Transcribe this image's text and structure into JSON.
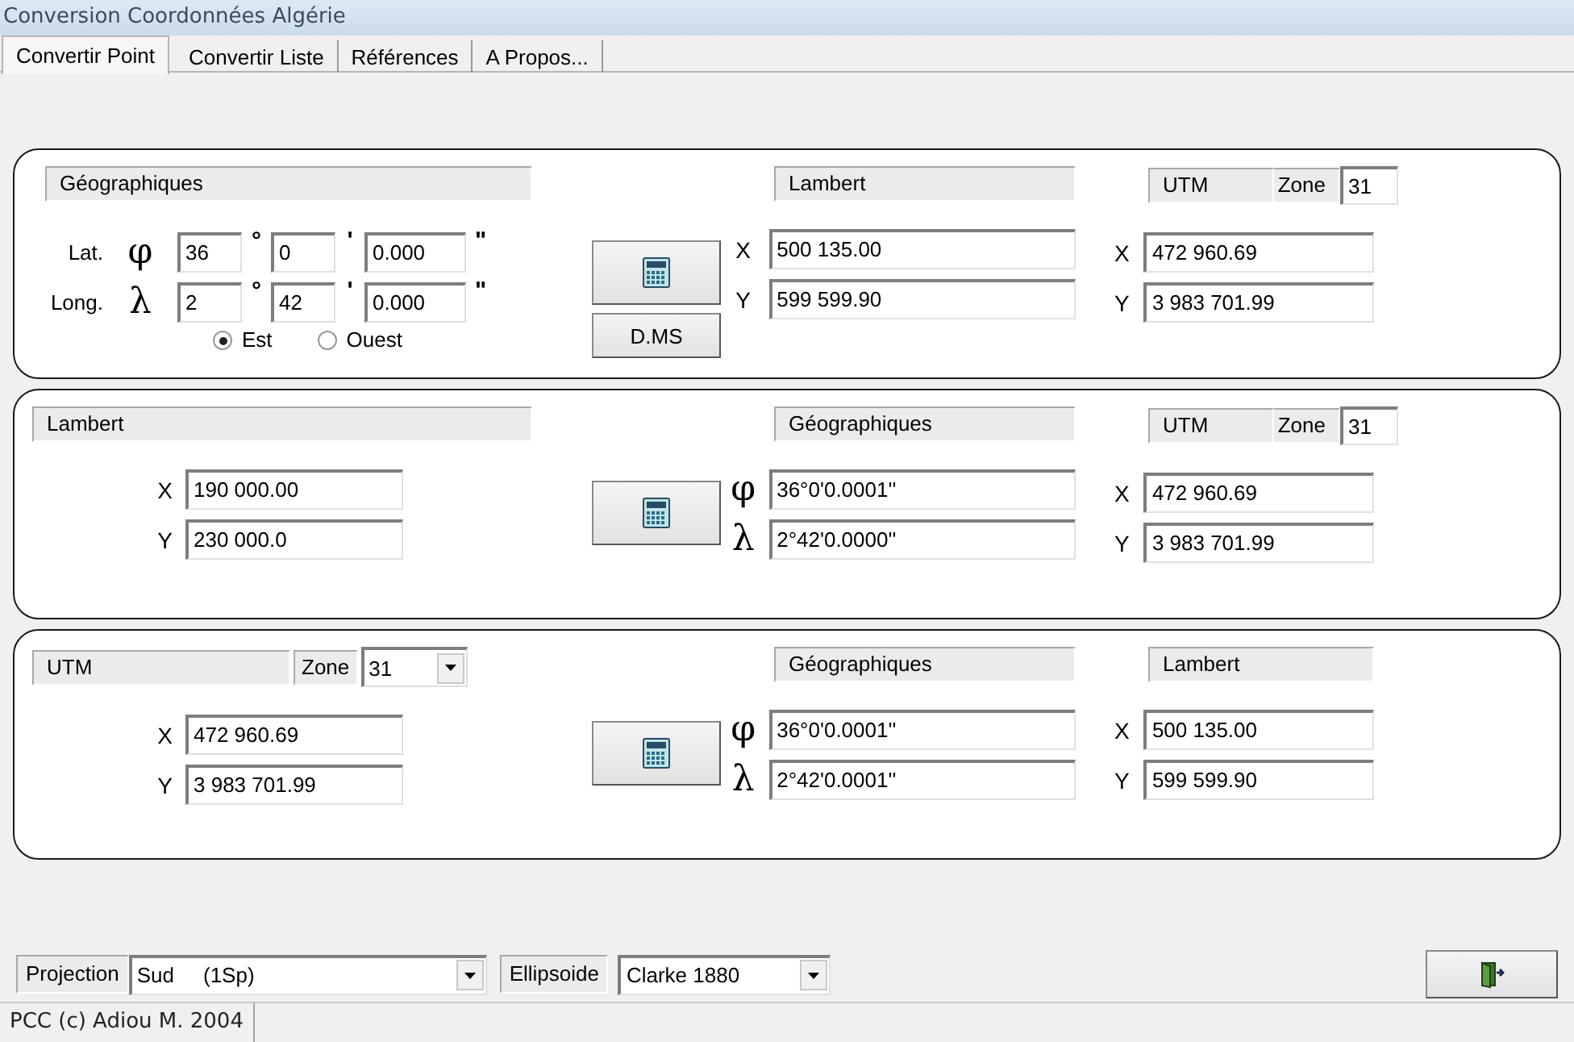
{
  "window": {
    "title": "Conversion Coordonnées Algérie"
  },
  "tabs": [
    {
      "label": "Convertir Point",
      "selected": true
    },
    {
      "label": "Convertir Liste",
      "selected": false
    },
    {
      "label": "Références",
      "selected": false
    },
    {
      "label": "A Propos...",
      "selected": false
    }
  ],
  "panels": [
    {
      "input": {
        "kind": "dms",
        "header": "Géographiques",
        "rows": [
          {
            "label": "Lat.",
            "symbol": "φ",
            "degrees": "36",
            "degree_mark": "°",
            "minutes": "0",
            "minute_mark": "'",
            "seconds": "0.000",
            "second_mark": "\""
          },
          {
            "label": "Long.",
            "symbol": "λ",
            "degrees": "2",
            "degree_mark": "°",
            "minutes": "42",
            "minute_mark": "'",
            "seconds": "0.000",
            "second_mark": "\""
          }
        ],
        "hemisphere": [
          {
            "label": "Est",
            "selected": true
          },
          {
            "label": "Ouest",
            "selected": false
          }
        ]
      },
      "dms_button": "D.MS",
      "outputs": [
        {
          "header": "Lambert",
          "fields": [
            {
              "axis": "X",
              "value": "500 135.00"
            },
            {
              "axis": "Y",
              "value": "599 599.90"
            }
          ]
        },
        {
          "header": "UTM",
          "zone": {
            "label": "Zone",
            "value": "31",
            "kind": "field"
          },
          "fields": [
            {
              "axis": "X",
              "value": "472 960.69"
            },
            {
              "axis": "Y",
              "value": "3 983 701.99"
            }
          ]
        }
      ]
    },
    {
      "input": {
        "kind": "plain",
        "header": "Lambert",
        "fields": [
          {
            "axis": "X",
            "value": "190 000.00"
          },
          {
            "axis": "Y",
            "value": "230 000.0"
          }
        ]
      },
      "outputs": [
        {
          "header": "Géographiques",
          "fields": [
            {
              "axis": "φ",
              "value": "36°0'0.0001''"
            },
            {
              "axis": "λ",
              "value": "2°42'0.0000''"
            }
          ]
        },
        {
          "header": "UTM",
          "zone": {
            "label": "Zone",
            "value": "31",
            "kind": "field"
          },
          "fields": [
            {
              "axis": "X",
              "value": "472 960.69"
            },
            {
              "axis": "Y",
              "value": "3 983 701.99"
            }
          ]
        }
      ]
    },
    {
      "input": {
        "kind": "plain",
        "header": "UTM",
        "zone": {
          "label": "Zone",
          "value": "31",
          "kind": "dropdown"
        },
        "fields": [
          {
            "axis": "X",
            "value": "472 960.69"
          },
          {
            "axis": "Y",
            "value": "3 983 701.99"
          }
        ]
      },
      "outputs": [
        {
          "header": "Géographiques",
          "fields": [
            {
              "axis": "φ",
              "value": "36°0'0.0001''"
            },
            {
              "axis": "λ",
              "value": "2°42'0.0001''"
            }
          ]
        },
        {
          "header": "Lambert",
          "fields": [
            {
              "axis": "X",
              "value": "500 135.00"
            },
            {
              "axis": "Y",
              "value": "599 599.90"
            }
          ]
        }
      ]
    }
  ],
  "projection": {
    "label": "Projection",
    "value": "Sud     (1Sp)"
  },
  "ellipsoid": {
    "label": "Ellipsoide",
    "value": "Clarke 1880"
  },
  "status_bar": "PCC (c) Adiou M. 2004"
}
